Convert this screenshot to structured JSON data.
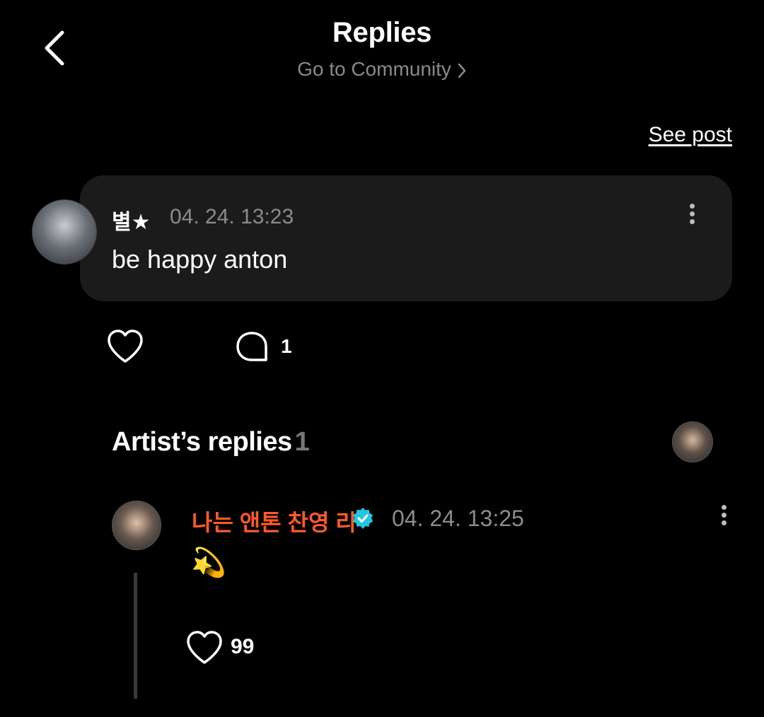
{
  "header": {
    "title": "Replies",
    "community_link": "Go to Community",
    "see_post": "See post"
  },
  "comment": {
    "author": "별★",
    "time": "04. 24. 13:23",
    "text": "be happy anton",
    "reply_count": "1"
  },
  "artist_replies": {
    "title": "Artist’s replies",
    "count": "1",
    "reply": {
      "author": "나는 앤톤 찬영 리",
      "time": "04. 24. 13:25",
      "text": "💫",
      "like_count": "99"
    }
  },
  "colors": {
    "background": "#000000",
    "card": "#1b1b1b",
    "artist_name": "#ff5a28",
    "verified": "#22c7e0",
    "muted": "#8c8c8c"
  }
}
